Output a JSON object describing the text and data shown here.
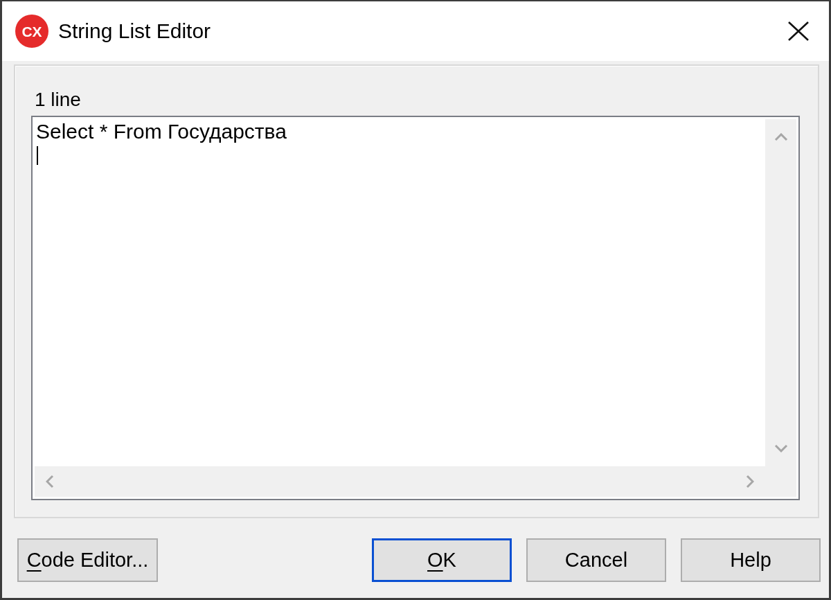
{
  "window": {
    "icon_text": "CX",
    "title": "String List Editor"
  },
  "editor": {
    "label": "1 line",
    "lines": [
      "Select * From Государства"
    ],
    "caret_on_new_line": true
  },
  "footer": {
    "left_buttons": [
      {
        "label": "Code Editor...",
        "mnemonic": true,
        "default": false
      }
    ],
    "right_buttons": [
      {
        "label": "OK",
        "mnemonic": true,
        "default": true
      },
      {
        "label": "Cancel",
        "mnemonic": false,
        "default": false
      },
      {
        "label": "Help",
        "mnemonic": false,
        "default": false
      }
    ]
  }
}
